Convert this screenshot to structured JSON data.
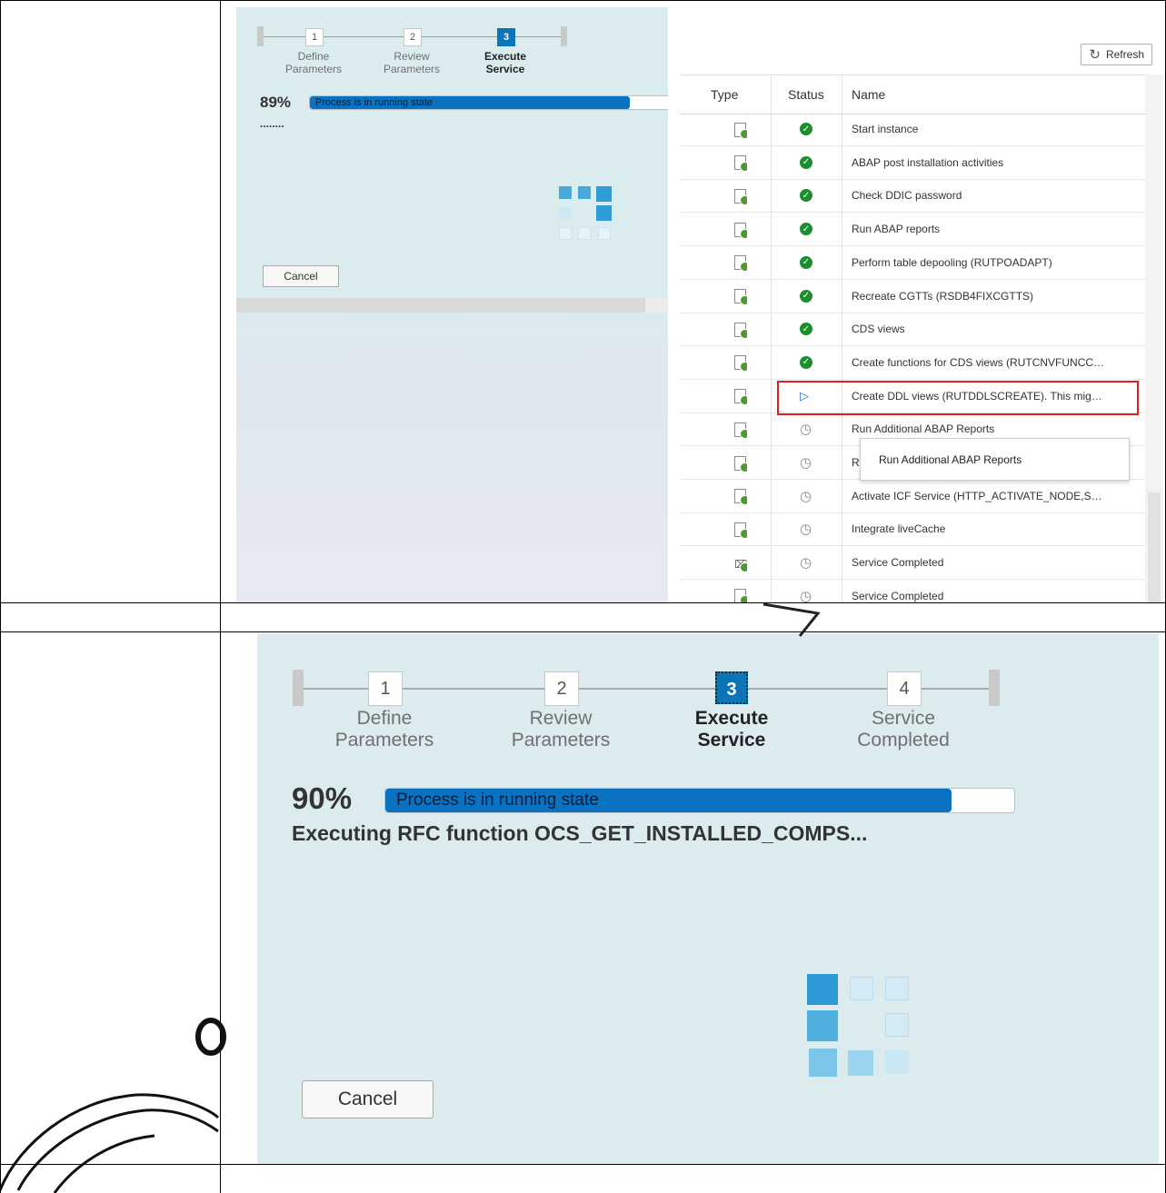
{
  "top": {
    "wizard": {
      "steps": [
        {
          "number": "1",
          "label_line1": "Define",
          "label_line2": "Parameters",
          "active": false
        },
        {
          "number": "2",
          "label_line1": "Review",
          "label_line2": "Parameters",
          "active": false
        },
        {
          "number": "3",
          "label_line1": "Execute",
          "label_line2": "Service",
          "active": true
        }
      ],
      "progress_percent_text": "89%",
      "progress_value": 89,
      "progress_status": "Process is in running state",
      "message": "........",
      "cancel_label": "Cancel"
    },
    "task_table": {
      "refresh_label": "Refresh",
      "columns": [
        "Type",
        "Status",
        "Name"
      ],
      "rows": [
        {
          "type": "step",
          "status": "completed",
          "name": "Start instance"
        },
        {
          "type": "step",
          "status": "completed",
          "name": "ABAP post installation activities"
        },
        {
          "type": "step",
          "status": "completed",
          "name": "Check DDIC password"
        },
        {
          "type": "step",
          "status": "completed",
          "name": "Run ABAP reports"
        },
        {
          "type": "step",
          "status": "completed",
          "name": "Perform table depooling (RUTPOADAPT)"
        },
        {
          "type": "step",
          "status": "completed",
          "name": "Recreate CGTTs (RSDB4FIXCGTTS)"
        },
        {
          "type": "step",
          "status": "completed",
          "name": "CDS views"
        },
        {
          "type": "step",
          "status": "completed",
          "name": "Create functions for CDS views (RUTCNVFUNCC…"
        },
        {
          "type": "step",
          "status": "running",
          "name": "Create DDL views (RUTDDLSCREATE). This mig…"
        },
        {
          "type": "step",
          "status": "waiting",
          "name": "Run Additional ABAP Reports"
        },
        {
          "type": "step",
          "status": "waiting",
          "name": "R"
        },
        {
          "type": "step",
          "status": "waiting",
          "name": "Activate ICF Service (HTTP_ACTIVATE_NODE,S…"
        },
        {
          "type": "step",
          "status": "waiting",
          "name": "Integrate liveCache"
        },
        {
          "type": "end",
          "status": "waiting",
          "name": "Service Completed"
        },
        {
          "type": "step",
          "status": "waiting",
          "name": "Service Completed"
        }
      ],
      "tooltip": "Run Additional ABAP Reports"
    }
  },
  "bottom": {
    "wizard": {
      "steps": [
        {
          "number": "1",
          "label_line1": "Define",
          "label_line2": "Parameters",
          "active": false
        },
        {
          "number": "2",
          "label_line1": "Review",
          "label_line2": "Parameters",
          "active": false
        },
        {
          "number": "3",
          "label_line1": "Execute",
          "label_line2": "Service",
          "active": true
        },
        {
          "number": "4",
          "label_line1": "Service",
          "label_line2": "Completed",
          "active": false
        }
      ],
      "progress_percent_text": "90%",
      "progress_value": 90,
      "progress_status": "Process is in running state",
      "message": "Executing RFC function OCS_GET_INSTALLED_COMPS...",
      "cancel_label": "Cancel"
    }
  },
  "colors": {
    "accent": "#0e74b8",
    "progress_fill": "#0a72c0",
    "wizard_bg": "#dcecee",
    "status_ok": "#1a8f2c",
    "highlight": "#e02020"
  }
}
